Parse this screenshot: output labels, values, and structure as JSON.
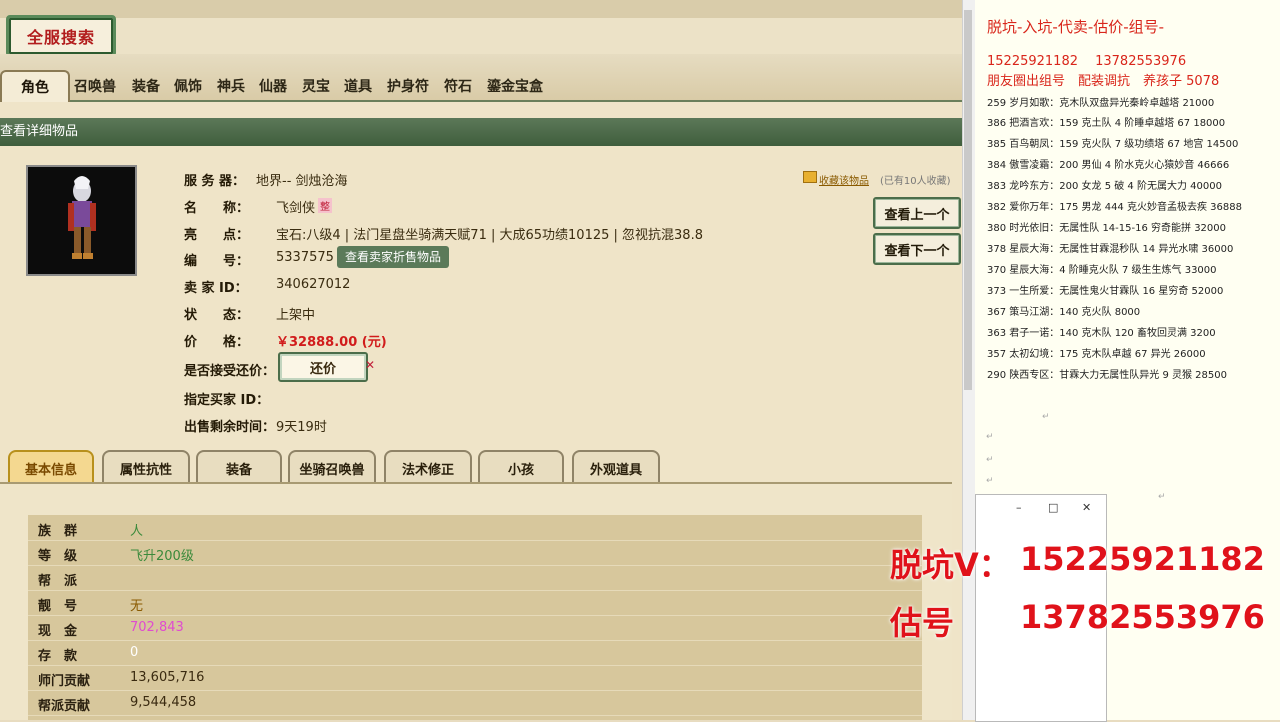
{
  "search_button": "全服搜索",
  "categories": [
    "角色",
    "召唤兽",
    "装备",
    "佩饰",
    "神兵",
    "仙器",
    "灵宝",
    "道具",
    "护身符",
    "符石",
    "鎏金宝盒"
  ],
  "detail_bar": "查看详细物品",
  "item": {
    "server_label": "服 务 器：",
    "server_value": "地界-- 剑烛沧海",
    "name_label": "名　　称：",
    "name_value": "飞剑侠",
    "name_badge": "整",
    "highlight_label": "亮　　点：",
    "highlight_value": "宝石:八级4 | 法门星盘坐骑满天赋71 | 大成65功绩10125 | 忽视抗混38.8",
    "id_label": "编　　号：",
    "id_value": "5337575",
    "seller_button": "查看卖家折售物品",
    "seller_label": "卖 家 ID：",
    "seller_value": "340627012",
    "status_label": "状　　态：",
    "status_value": "上架中",
    "price_label": "价　　格：",
    "price_value": "￥32888.00 (元)",
    "bargain_label": "是否接受还价：",
    "bargain_button": "还价",
    "buyer_label": "指定买家 ID：",
    "remain_label": "出售剩余时间：",
    "remain_value": "9天19时",
    "favorite_link": "收藏该物品",
    "favorite_count": "(已有10人收藏)"
  },
  "nav": {
    "prev": "查看上一个",
    "next": "查看下一个"
  },
  "subtabs": [
    "基本信息",
    "属性抗性",
    "装备",
    "坐骑召唤兽",
    "法术修正",
    "小孩",
    "外观道具"
  ],
  "info_rows": [
    {
      "k": "族　群",
      "v": "人",
      "color": "#3b8a3b"
    },
    {
      "k": "等　级",
      "v": "飞升200级",
      "color": "#3b8a3b"
    },
    {
      "k": "帮　派",
      "v": "",
      "color": "#333"
    },
    {
      "k": "靓　号",
      "v": "无",
      "color": "#8a5a00"
    },
    {
      "k": "现　金",
      "v": "702,843",
      "color": "#e04bd0"
    },
    {
      "k": "存　款",
      "v": "0",
      "color": "#ffffff"
    },
    {
      "k": "师门贡献",
      "v": "13,605,716",
      "color": "#3a2c10"
    },
    {
      "k": "帮派贡献",
      "v": "9,544,458",
      "color": "#3a2c10"
    }
  ],
  "notes": {
    "headline": "脱坑-入坑-代卖-估价-组号-",
    "phones": "15225921182　 13782553976",
    "subline": "朋友圈出组号　配装调抗　养孩子 5078",
    "lines": [
      "259 岁月如歌：克木队双盘异光秦岭卓越塔 21000",
      "386 把酒言欢：159 克土队 4 阶睡卓越塔 67  18000",
      "385 百鸟朝凤：159 克火队 7 级功绩塔 67 地宫 14500",
      "384 傲雪凌霜：200 男仙 4 阶水克火心猿妙音 46666",
      "383 龙吟东方：200 女龙 5 破 4 阶无属大力 40000",
      "382 爱你万年：175 男龙 444 克火妙音孟极去疾 36888",
      "380 时光依旧：无属性队 14-15-16 穷奇能拼 32000",
      "378 星辰大海：无属性甘霖混秒队 14 异光水啸 36000",
      "370 星辰大海：4 阶睡克火队 7 级生生炼气 33000",
      "373 一生所爱：无属性鬼火甘霖队 16 星穷奇 52000",
      "367 策马江湖：140 克火队 8000",
      "363 君子一诺：140 克木队 120 畜牧回灵满 3200",
      "357 太初幻境：175 克木队卓越 67 异光 26000",
      "290 陕西专区：甘霖大力无属性队异光 9 灵猴 28500"
    ]
  },
  "overlay": {
    "line1_label": "脱坑V：",
    "line1_value": "15225921182",
    "line2_label": "估号",
    "line2_value": "13782553976"
  }
}
